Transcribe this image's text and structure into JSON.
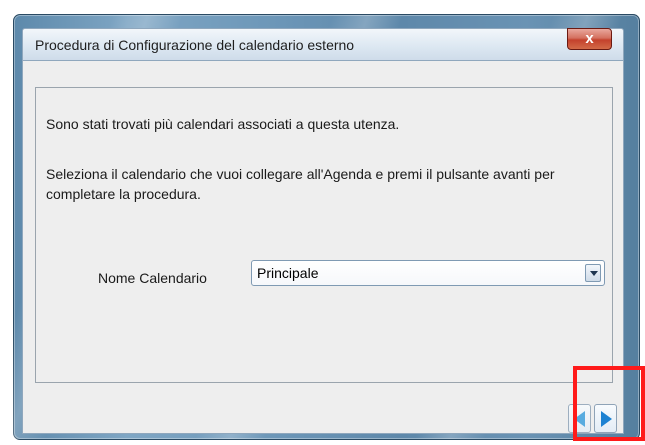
{
  "window": {
    "title": "Procedura di Configurazione del calendario esterno",
    "close_label": "x"
  },
  "content": {
    "message_found": "Sono stati trovati più calendari associati a questa utenza.",
    "message_instructions": "Seleziona il calendario che vuoi collegare all'Agenda e premi il pulsante avanti per completare la procedura."
  },
  "form": {
    "calendar_name_label": "Nome Calendario",
    "calendar_name_value": "Principale"
  },
  "navigation": {
    "back_icon": "arrow-left-icon",
    "next_icon": "arrow-right-icon"
  },
  "colors": {
    "highlight": "#ff1a1a",
    "arrow": "#1d82d2"
  }
}
